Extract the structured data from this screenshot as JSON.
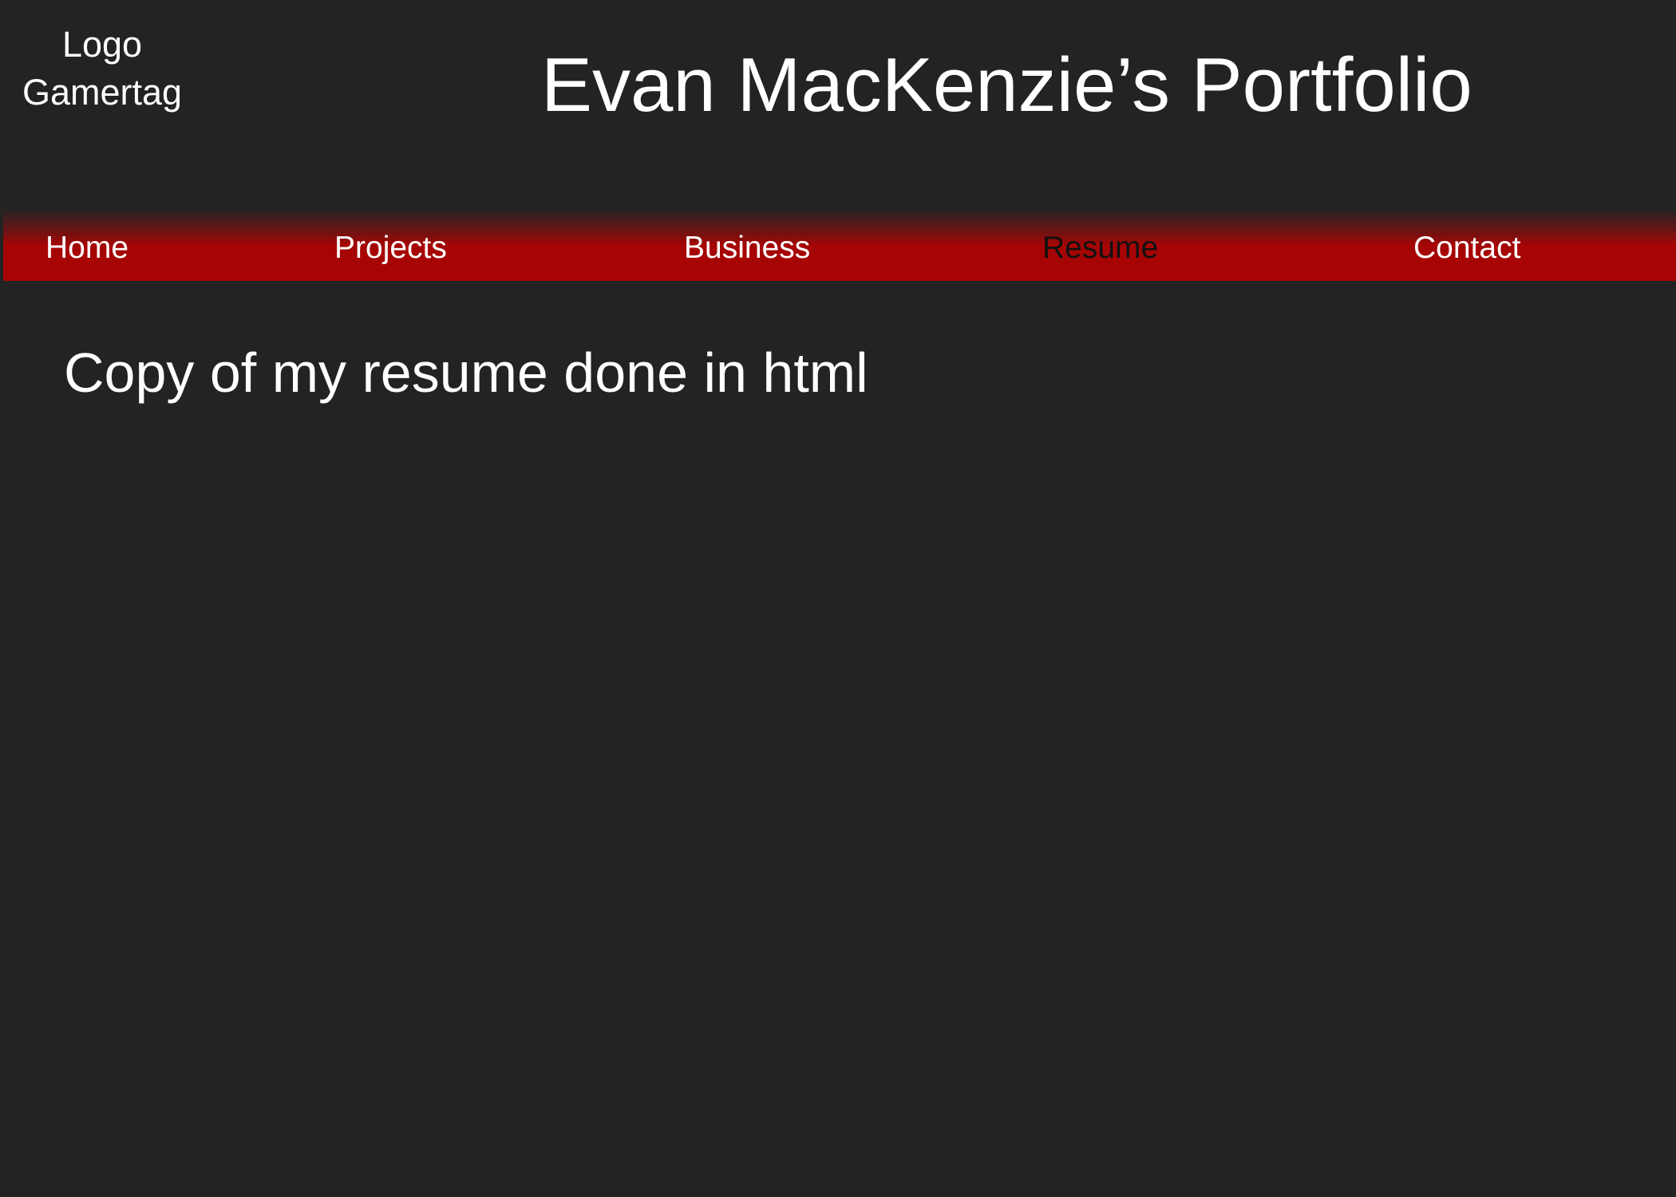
{
  "header": {
    "logo_line1": "Logo",
    "logo_line2": "Gamertag",
    "title": "Evan MacKenzie’s Portfolio"
  },
  "nav": {
    "items": [
      {
        "label": "Home"
      },
      {
        "label": "Projects"
      },
      {
        "label": "Business"
      },
      {
        "label": "Resume",
        "active": true
      },
      {
        "label": "Contact"
      }
    ],
    "colors": {
      "bar": "#a80404",
      "active_text": "#111111"
    }
  },
  "main": {
    "text": "Copy of my resume done in html"
  }
}
